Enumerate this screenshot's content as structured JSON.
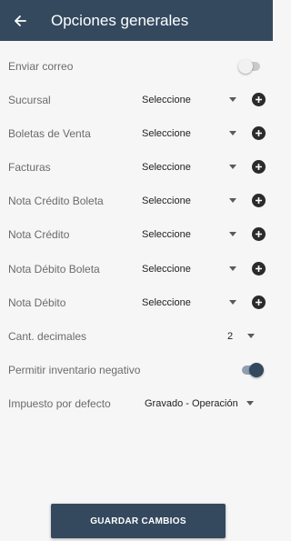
{
  "header": {
    "title": "Opciones generales",
    "back_icon": "arrow-left-icon"
  },
  "colors": {
    "header_bg": "#34495e",
    "accent": "#34495e",
    "background": "#f6f6f6"
  },
  "settings": {
    "enviar_correo": {
      "label": "Enviar correo",
      "enabled": false
    },
    "sucursal": {
      "label": "Sucursal",
      "value": "Seleccione"
    },
    "boletas_venta": {
      "label": "Boletas de Venta",
      "value": "Seleccione"
    },
    "facturas": {
      "label": "Facturas",
      "value": "Seleccione"
    },
    "nota_credito_boleta": {
      "label": "Nota Crédito Boleta",
      "value": "Seleccione"
    },
    "nota_credito": {
      "label": "Nota Crédito",
      "value": "Seleccione"
    },
    "nota_debito_boleta": {
      "label": "Nota Débito Boleta",
      "value": "Seleccione"
    },
    "nota_debito": {
      "label": "Nota Débito",
      "value": "Seleccione"
    },
    "cant_decimales": {
      "label": "Cant. decimales",
      "value": "2"
    },
    "inventario_negativo": {
      "label": "Permitir inventario negativo",
      "enabled": true
    },
    "impuesto": {
      "label": "Impuesto por defecto",
      "value": "Gravado - Operación"
    }
  },
  "save_button": {
    "label": "GUARDAR CAMBIOS"
  }
}
